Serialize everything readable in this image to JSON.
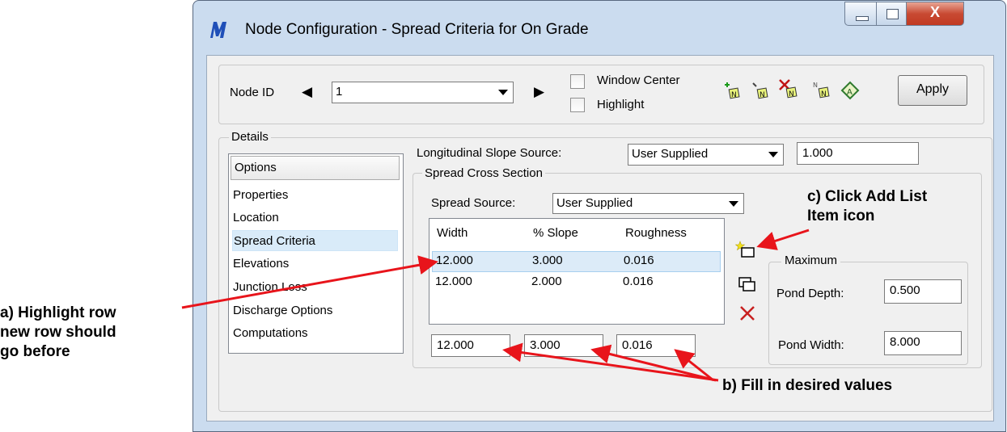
{
  "window": {
    "title": "Node Configuration - Spread Criteria for On Grade",
    "close_glyph": "X"
  },
  "toolbar": {
    "node_id_label": "Node ID",
    "prev_glyph": "◀",
    "next_glyph": "▶",
    "node_id_value": "1",
    "window_center_label": "Window Center",
    "highlight_label": "Highlight",
    "apply_label": "Apply"
  },
  "details": {
    "label": "Details",
    "options_header": "Options",
    "options": [
      "Properties",
      "Location",
      "Spread Criteria",
      "Elevations",
      "Junction Loss",
      "Discharge Options",
      "Computations"
    ],
    "selected_option": "Spread Criteria"
  },
  "slope": {
    "label": "Longitudinal Slope Source:",
    "source": "User Supplied",
    "value": "1.000"
  },
  "spread": {
    "section_label": "Spread Cross Section",
    "source_label": "Spread Source:",
    "source_value": "User Supplied",
    "columns": [
      "Width",
      "% Slope",
      "Roughness"
    ],
    "rows": [
      [
        "12.000",
        "3.000",
        "0.016"
      ],
      [
        "12.000",
        "2.000",
        "0.016"
      ]
    ],
    "inputs": [
      "12.000",
      "3.000",
      "0.016"
    ]
  },
  "maximum": {
    "label": "Maximum",
    "pond_depth_label": "Pond Depth:",
    "pond_depth_value": "0.500",
    "pond_width_label": "Pond Width:",
    "pond_width_value": "8.000"
  },
  "annotations": {
    "a": "a) Highlight row\nnew row should\ngo before",
    "b": "b) Fill in desired values",
    "c": "c) Click Add List\nItem icon"
  },
  "colors": {
    "arrow": "#e8141b",
    "selection": "#dcebf8",
    "window_frame": "#cbdcef"
  }
}
